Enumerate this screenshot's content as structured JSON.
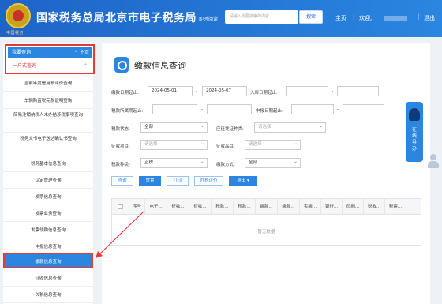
{
  "header": {
    "emblem_text": "中国税务",
    "title": "国家税务总局北京市电子税务局",
    "subtitle": "即时阅读",
    "search_placeholder": "请输入需要搜索的内容",
    "search_button": "搜索",
    "home": "主页",
    "welcome": "欢迎,",
    "exit": "退出"
  },
  "sidebar": {
    "top_label": "我要查询",
    "top_home": "主页",
    "section": "一户式查询",
    "items": [
      "当前年度信用预评价查询",
      "车辆购置税完税证明查询",
      "简易注销纳税人未办结涉税事项查询",
      "税务文书电子送达确认书查询",
      "税务基本信息查询",
      "认定管理查询",
      "发票信息查询",
      "发票业务查询",
      "发票领购信息查询",
      "申报信息查询",
      "缴款信息查询",
      "征收信息查询",
      "欠税信息查询"
    ],
    "active_index": 10
  },
  "main": {
    "page_title": "缴款信息查询",
    "form": {
      "pay_date_label": "缴款日期起止:",
      "pay_date_from": "2024-05-01",
      "pay_date_to": "2024-05-07",
      "entry_date_label": "入库日期起止:",
      "tax_period_label": "税款所属期起止:",
      "declare_date_label": "申报日期起止:",
      "tax_status_label": "税款状态:",
      "tax_status_value": "全部",
      "voucher_type_label": "应征凭证种类:",
      "voucher_type_value": "请选择",
      "project_label": "征收项目:",
      "project_value": "请选择",
      "item_label": "征收品目:",
      "item_value": "请选择",
      "tax_kind_label": "税款种类:",
      "tax_kind_value": "正税",
      "pay_method_label": "缴款方式:",
      "pay_method_value": "全部"
    },
    "buttons": [
      "查询",
      "重置",
      "打印",
      "办税评价",
      "导出 ▾"
    ],
    "table": {
      "columns": [
        "序号",
        "电子...",
        "征收...",
        "征收...",
        "税款...",
        "税款...",
        "缴款...",
        "缴款...",
        "实缴...",
        "银行...",
        "印刷...",
        "税收...",
        "税票..."
      ],
      "empty_text": "暂无数据"
    }
  },
  "guide": {
    "text": "在线导办"
  }
}
